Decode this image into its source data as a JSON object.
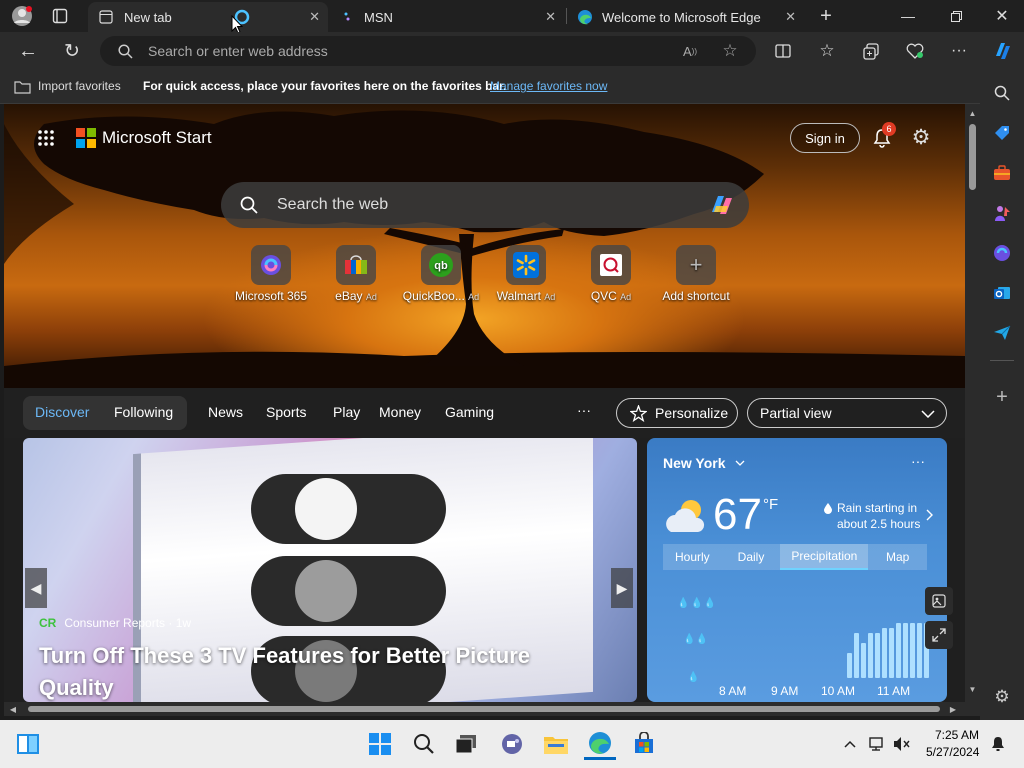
{
  "browser": {
    "tabs": [
      {
        "title": "New tab",
        "active": true
      },
      {
        "title": "MSN",
        "active": false
      },
      {
        "title": "Welcome to Microsoft Edge",
        "active": false
      }
    ],
    "address_placeholder": "Search or enter web address"
  },
  "favorites_bar": {
    "import_label": "Import favorites",
    "message": "For quick access, place your favorites here on the favorites bar.",
    "manage_link": "Manage favorites now"
  },
  "newtab": {
    "brand": "Microsoft Start",
    "sign_in": "Sign in",
    "notification_count": "6",
    "search_placeholder": "Search the web",
    "shortcuts": [
      {
        "label": "Microsoft 365",
        "ad": ""
      },
      {
        "label": "eBay",
        "ad": "Ad"
      },
      {
        "label": "QuickBoo...",
        "ad": "Ad"
      },
      {
        "label": "Walmart",
        "ad": "Ad"
      },
      {
        "label": "QVC",
        "ad": "Ad"
      },
      {
        "label": "Add shortcut",
        "ad": ""
      }
    ]
  },
  "feed": {
    "tabs": [
      "Discover",
      "Following",
      "News",
      "Sports",
      "Play",
      "Money",
      "Gaming"
    ],
    "more": "···",
    "personalize": "Personalize",
    "view_select": "Partial view"
  },
  "article": {
    "source_logo": "CR",
    "source": "Consumer Reports · 1w",
    "headline": "Turn Off These 3 TV Features for Better Picture Quality"
  },
  "weather": {
    "location": "New York",
    "temperature": "67",
    "unit": "°F",
    "alert_line1": "Rain starting in",
    "alert_line2": "about 2.5 hours",
    "tabs": [
      "Hourly",
      "Daily",
      "Precipitation",
      "Map"
    ],
    "active_tab": "Precipitation",
    "time_labels": [
      "8 AM",
      "9 AM",
      "10 AM",
      "11 AM"
    ],
    "precip_bars": [
      0.25,
      0.45,
      0.35,
      0.45,
      0.45,
      0.5,
      0.5,
      0.55,
      0.55,
      0.55,
      0.55,
      0.55
    ]
  },
  "taskbar": {
    "time": "7:25 AM",
    "date": "5/27/2024"
  },
  "colors": {
    "accent": "#4cc2ff",
    "link": "#6cb8f6",
    "notification_badge": "#e03b24"
  }
}
